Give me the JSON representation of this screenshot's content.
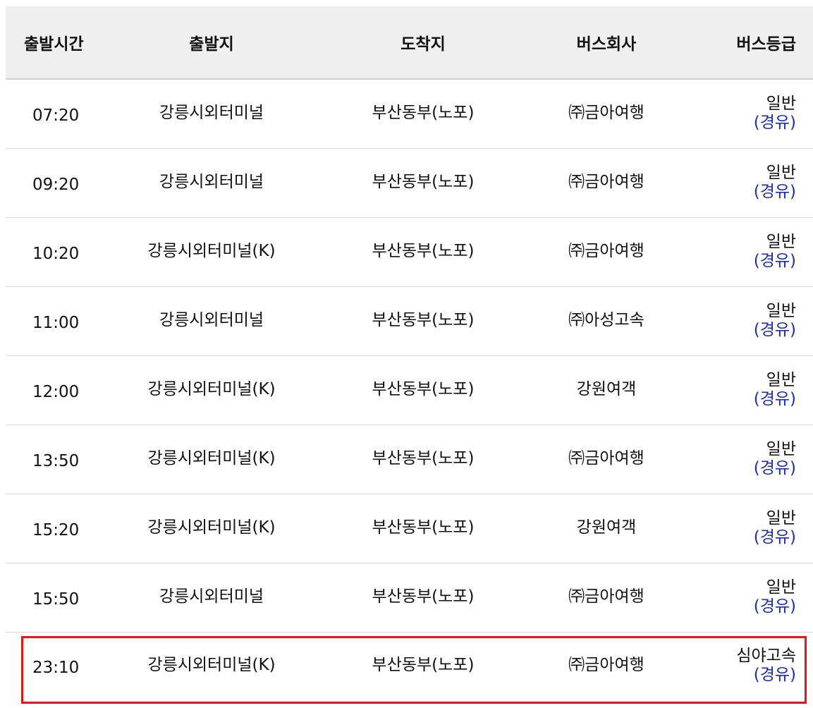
{
  "headers": {
    "time": "출발시간",
    "from": "출발지",
    "to": "도착지",
    "company": "버스회사",
    "grade": "버스등급"
  },
  "rows": [
    {
      "time": "07:20",
      "from": "강릉시외터미널",
      "to": "부산동부(노포)",
      "company": "㈜금아여행",
      "grade": "일반",
      "via": "(경유)"
    },
    {
      "time": "09:20",
      "from": "강릉시외터미널",
      "to": "부산동부(노포)",
      "company": "㈜금아여행",
      "grade": "일반",
      "via": "(경유)"
    },
    {
      "time": "10:20",
      "from": "강릉시외터미널(K)",
      "to": "부산동부(노포)",
      "company": "㈜금아여행",
      "grade": "일반",
      "via": "(경유)"
    },
    {
      "time": "11:00",
      "from": "강릉시외터미널",
      "to": "부산동부(노포)",
      "company": "㈜아성고속",
      "grade": "일반",
      "via": "(경유)"
    },
    {
      "time": "12:00",
      "from": "강릉시외터미널(K)",
      "to": "부산동부(노포)",
      "company": "강원여객",
      "grade": "일반",
      "via": "(경유)"
    },
    {
      "time": "13:50",
      "from": "강릉시외터미널(K)",
      "to": "부산동부(노포)",
      "company": "㈜금아여행",
      "grade": "일반",
      "via": "(경유)"
    },
    {
      "time": "15:20",
      "from": "강릉시외터미널(K)",
      "to": "부산동부(노포)",
      "company": "강원여객",
      "grade": "일반",
      "via": "(경유)"
    },
    {
      "time": "15:50",
      "from": "강릉시외터미널",
      "to": "부산동부(노포)",
      "company": "㈜금아여행",
      "grade": "일반",
      "via": "(경유)"
    },
    {
      "time": "23:10",
      "from": "강릉시외터미널(K)",
      "to": "부산동부(노포)",
      "company": "㈜금아여행",
      "grade": "심야고속",
      "via": "(경유)"
    }
  ],
  "colors": {
    "header_bg": "#efefef",
    "via_text": "#1a2fb8",
    "highlight_border": "#e8141b"
  }
}
